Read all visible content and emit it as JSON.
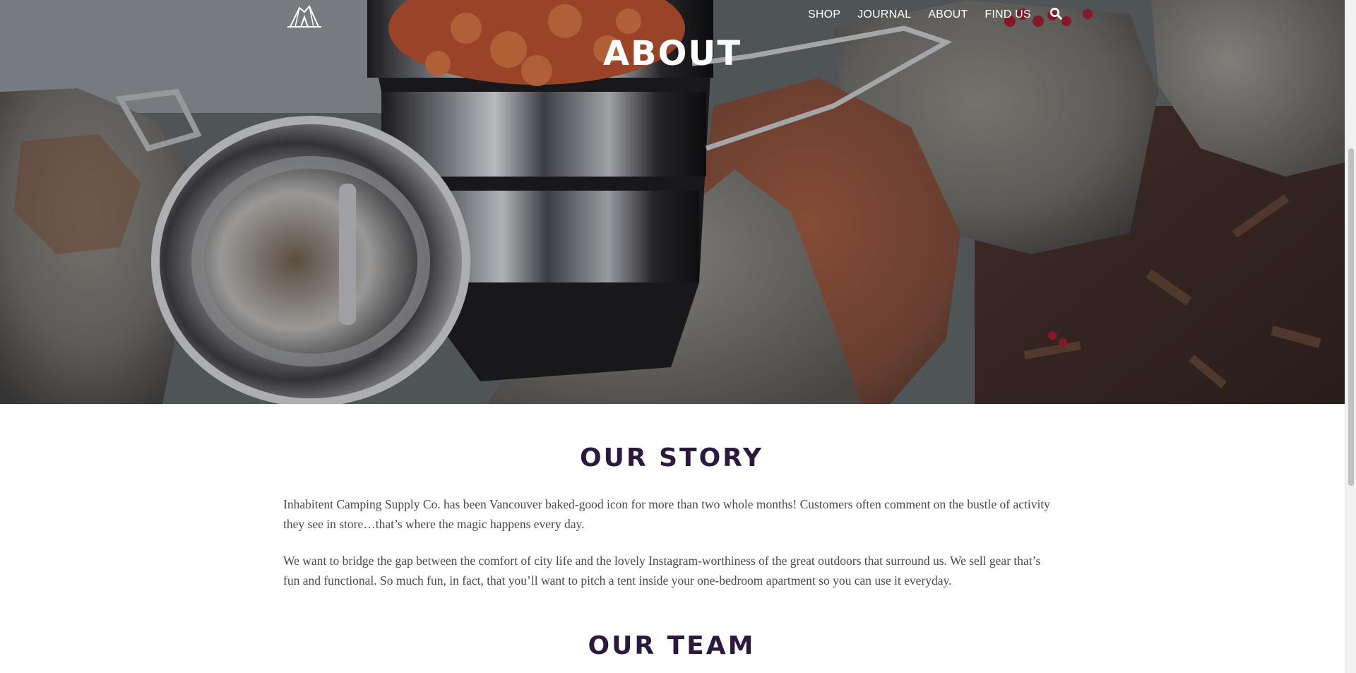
{
  "nav": {
    "logo_alt": "Inhabitent logo",
    "links": [
      "SHOP",
      "JOURNAL",
      "ABOUT",
      "FIND US"
    ],
    "search_icon": "search-icon"
  },
  "hero": {
    "title": "ABOUT"
  },
  "story": {
    "title": "OUR STORY",
    "paragraphs": [
      "Inhabitent Camping Supply Co. has been Vancouver baked-good icon for more than two whole months! Customers often comment on the bustle of activity they see in store…that’s where the magic happens every day.",
      "We want to bridge the gap between the comfort of city life and the lovely Instagram-worthiness of the great outdoors that surround us. We sell gear that’s fun and functional. So much fun, in fact, that you’ll want to pitch a tent inside your one-bedroom apartment so you can use it everyday."
    ]
  },
  "team": {
    "title": "OUR TEAM"
  },
  "colors": {
    "heading": "#2b1a3e",
    "body_text": "#4a4a4a",
    "nav_text": "#ffffff"
  }
}
